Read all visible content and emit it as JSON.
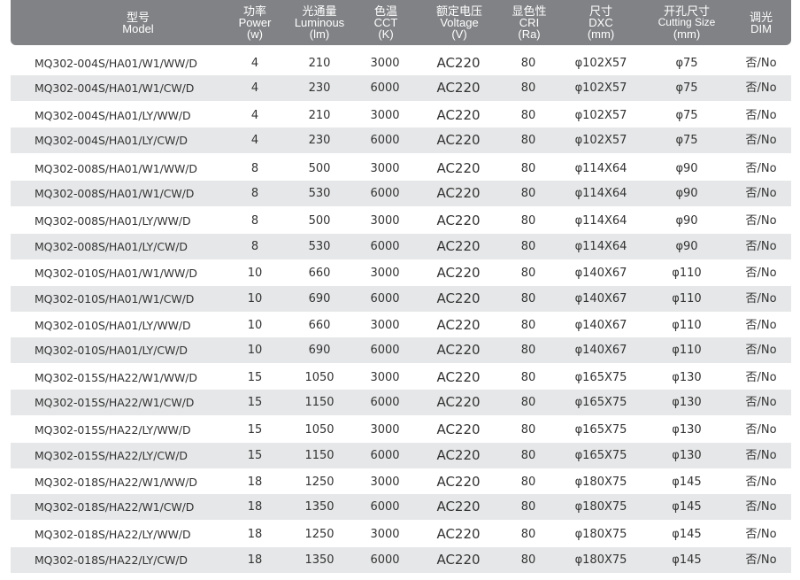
{
  "header": {
    "model": {
      "cn": "型号",
      "en": "Model"
    },
    "power": {
      "cn": "功率",
      "en": "Power",
      "unit": "(w)"
    },
    "luminous": {
      "cn": "光通量",
      "en": "Luminous",
      "unit": "(lm)"
    },
    "cct": {
      "cn": "色温",
      "en": "CCT",
      "unit": "(K)"
    },
    "voltage": {
      "cn": "额定电压",
      "en": "Voltage",
      "unit": "(V)"
    },
    "cri": {
      "cn": "显色性",
      "en": "CRI",
      "unit": "(Ra)"
    },
    "dxc": {
      "cn": "尺寸",
      "en": "DXC",
      "unit": "(mm)"
    },
    "cutting": {
      "cn": "开孔尺寸",
      "en": "Cutting Size",
      "unit": "(mm)"
    },
    "dim": {
      "cn": "调光",
      "en": "DIM"
    }
  },
  "rows": [
    {
      "model": "MQ302-004S/HA01/W1/WW/D",
      "power": "4",
      "lm": "210",
      "cct": "3000",
      "voltage": "AC220",
      "cri": "80",
      "size": "φ102X57",
      "cut": "φ75",
      "dim": "否/No"
    },
    {
      "model": "MQ302-004S/HA01/W1/CW/D",
      "power": "4",
      "lm": "230",
      "cct": "6000",
      "voltage": "AC220",
      "cri": "80",
      "size": "φ102X57",
      "cut": "φ75",
      "dim": "否/No"
    },
    {
      "model": "MQ302-004S/HA01/LY/WW/D",
      "power": "4",
      "lm": "210",
      "cct": "3000",
      "voltage": "AC220",
      "cri": "80",
      "size": "φ102X57",
      "cut": "φ75",
      "dim": "否/No"
    },
    {
      "model": "MQ302-004S/HA01/LY/CW/D",
      "power": "4",
      "lm": "230",
      "cct": "6000",
      "voltage": "AC220",
      "cri": "80",
      "size": "φ102X57",
      "cut": "φ75",
      "dim": "否/No"
    },
    {
      "model": "MQ302-008S/HA01/W1/WW/D",
      "power": "8",
      "lm": "500",
      "cct": "3000",
      "voltage": "AC220",
      "cri": "80",
      "size": "φ114X64",
      "cut": "φ90",
      "dim": "否/No"
    },
    {
      "model": "MQ302-008S/HA01/W1/CW/D",
      "power": "8",
      "lm": "530",
      "cct": "6000",
      "voltage": "AC220",
      "cri": "80",
      "size": "φ114X64",
      "cut": "φ90",
      "dim": "否/No"
    },
    {
      "model": "MQ302-008S/HA01/LY/WW/D",
      "power": "8",
      "lm": "500",
      "cct": "3000",
      "voltage": "AC220",
      "cri": "80",
      "size": "φ114X64",
      "cut": "φ90",
      "dim": "否/No"
    },
    {
      "model": "MQ302-008S/HA01/LY/CW/D",
      "power": "8",
      "lm": "530",
      "cct": "6000",
      "voltage": "AC220",
      "cri": "80",
      "size": "φ114X64",
      "cut": "φ90",
      "dim": "否/No"
    },
    {
      "model": "MQ302-010S/HA01/W1/WW/D",
      "power": "10",
      "lm": "660",
      "cct": "3000",
      "voltage": "AC220",
      "cri": "80",
      "size": "φ140X67",
      "cut": "φ110",
      "dim": "否/No"
    },
    {
      "model": "MQ302-010S/HA01/W1/CW/D",
      "power": "10",
      "lm": "690",
      "cct": "6000",
      "voltage": "AC220",
      "cri": "80",
      "size": "φ140X67",
      "cut": "φ110",
      "dim": "否/No"
    },
    {
      "model": "MQ302-010S/HA01/LY/WW/D",
      "power": "10",
      "lm": "660",
      "cct": "3000",
      "voltage": "AC220",
      "cri": "80",
      "size": "φ140X67",
      "cut": "φ110",
      "dim": "否/No"
    },
    {
      "model": "MQ302-010S/HA01/LY/CW/D",
      "power": "10",
      "lm": "690",
      "cct": "6000",
      "voltage": "AC220",
      "cri": "80",
      "size": "φ140X67",
      "cut": "φ110",
      "dim": "否/No"
    },
    {
      "model": "MQ302-015S/HA22/W1/WW/D",
      "power": "15",
      "lm": "1050",
      "cct": "3000",
      "voltage": "AC220",
      "cri": "80",
      "size": "φ165X75",
      "cut": "φ130",
      "dim": "否/No"
    },
    {
      "model": "MQ302-015S/HA22/W1/CW/D",
      "power": "15",
      "lm": "1150",
      "cct": "6000",
      "voltage": "AC220",
      "cri": "80",
      "size": "φ165X75",
      "cut": "φ130",
      "dim": "否/No"
    },
    {
      "model": "MQ302-015S/HA22/LY/WW/D",
      "power": "15",
      "lm": "1050",
      "cct": "3000",
      "voltage": "AC220",
      "cri": "80",
      "size": "φ165X75",
      "cut": "φ130",
      "dim": "否/No"
    },
    {
      "model": "MQ302-015S/HA22/LY/CW/D",
      "power": "15",
      "lm": "1150",
      "cct": "6000",
      "voltage": "AC220",
      "cri": "80",
      "size": "φ165X75",
      "cut": "φ130",
      "dim": "否/No"
    },
    {
      "model": "MQ302-018S/HA22/W1/WW/D",
      "power": "18",
      "lm": "1250",
      "cct": "3000",
      "voltage": "AC220",
      "cri": "80",
      "size": "φ180X75",
      "cut": "φ145",
      "dim": "否/No"
    },
    {
      "model": "MQ302-018S/HA22/W1/CW/D",
      "power": "18",
      "lm": "1350",
      "cct": "6000",
      "voltage": "AC220",
      "cri": "80",
      "size": "φ180X75",
      "cut": "φ145",
      "dim": "否/No"
    },
    {
      "model": "MQ302-018S/HA22/LY/WW/D",
      "power": "18",
      "lm": "1250",
      "cct": "3000",
      "voltage": "AC220",
      "cri": "80",
      "size": "φ180X75",
      "cut": "φ145",
      "dim": "否/No"
    },
    {
      "model": "MQ302-018S/HA22/LY/CW/D",
      "power": "18",
      "lm": "1350",
      "cct": "6000",
      "voltage": "AC220",
      "cri": "80",
      "size": "φ180X75",
      "cut": "φ145",
      "dim": "否/No"
    }
  ],
  "colors": {
    "header_bg": "#808285",
    "row_shade": "#e6e7e8",
    "text": "#333333"
  }
}
